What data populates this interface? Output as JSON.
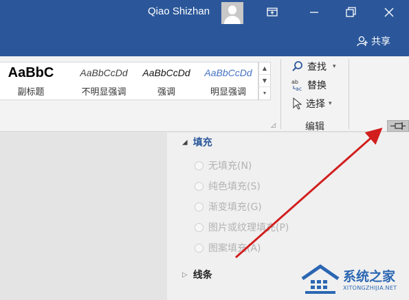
{
  "titlebar": {
    "username": "Qiao Shizhan",
    "share_label": "共享",
    "bg_color": "#2b579a"
  },
  "ribbon": {
    "styles": [
      {
        "preview": "AaBbC",
        "label": "副标题"
      },
      {
        "preview": "AaBbCcDd",
        "label": "不明显强调"
      },
      {
        "preview": "AaBbCcDd",
        "label": "强调"
      },
      {
        "preview": "AaBbCcDd",
        "label": "明显强调"
      }
    ],
    "editing": {
      "find_label": "查找",
      "replace_label": "替换",
      "select_label": "选择",
      "group_label": "编辑"
    }
  },
  "pane": {
    "fill": {
      "title": "填充",
      "options": [
        "无填充(N)",
        "纯色填充(S)",
        "渐变填充(G)",
        "图片或纹理填充(P)",
        "图案填充(A)"
      ]
    },
    "line": {
      "title": "线条"
    }
  },
  "watermark": {
    "text": "系统之家",
    "sub": "XITONGZHIJIA.NET"
  },
  "icons": {
    "user": "avatar-icon",
    "ribbon_display": "ribbon-display-options-icon",
    "minimize": "minimize-icon",
    "restore": "restore-icon",
    "close": "close-icon",
    "share": "share-person-icon",
    "find": "search-icon",
    "replace": "replace-icon",
    "select": "cursor-icon",
    "pin": "pin-icon"
  },
  "annotation": {
    "arrow_color": "#d21e1e"
  }
}
